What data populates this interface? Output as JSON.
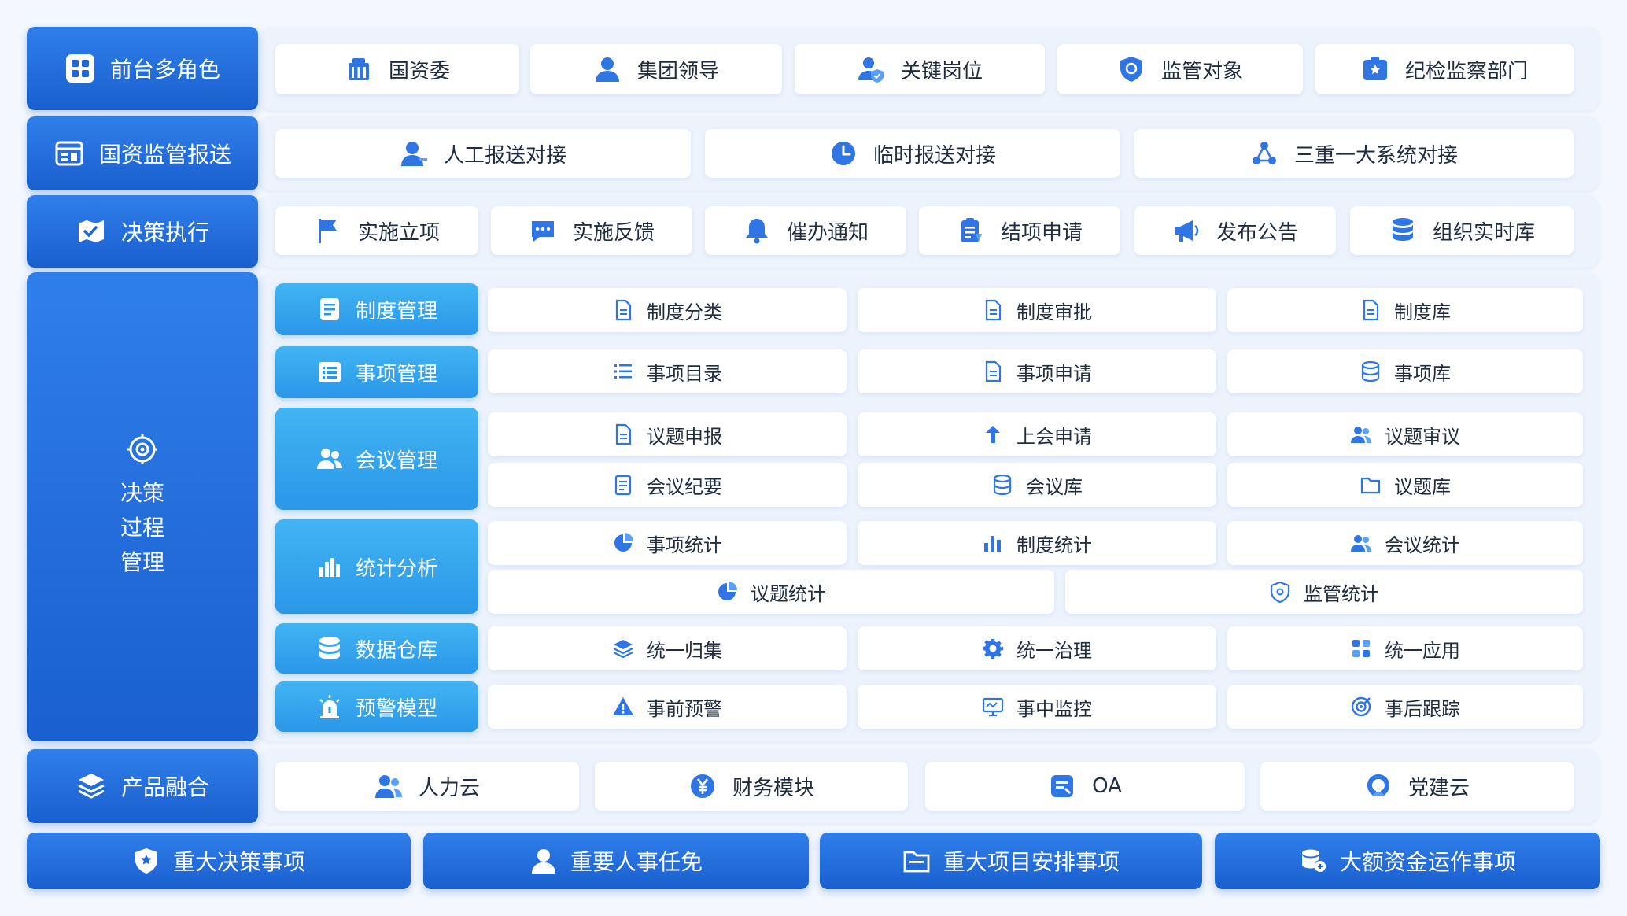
{
  "colors": {
    "primary": "#1a5fcf",
    "primary_light": "#2f7fea",
    "sub_accent": "#2a97e8",
    "icon_blue": "#2f76e4",
    "band_bg": "#edf3fc",
    "card_bg": "#ffffff",
    "text": "#1f2d3f"
  },
  "rows": {
    "roles": {
      "header": {
        "label": "前台多角色",
        "icon": "grid-icon"
      },
      "items": [
        {
          "label": "国资委",
          "icon": "building-icon"
        },
        {
          "label": "集团领导",
          "icon": "user-icon"
        },
        {
          "label": "关键岗位",
          "icon": "user-shield-icon"
        },
        {
          "label": "监管对象",
          "icon": "shield-icon"
        },
        {
          "label": "纪检监察部门",
          "icon": "badge-icon"
        }
      ]
    },
    "reporting": {
      "header": {
        "label": "国资监管报送",
        "icon": "report-icon"
      },
      "items": [
        {
          "label": "人工报送对接",
          "icon": "user-icon"
        },
        {
          "label": "临时报送对接",
          "icon": "clock-icon"
        },
        {
          "label": "三重一大系统对接",
          "icon": "network-icon"
        }
      ]
    },
    "execution": {
      "header": {
        "label": "决策执行",
        "icon": "check-map-icon"
      },
      "items": [
        {
          "label": "实施立项",
          "icon": "flag-icon"
        },
        {
          "label": "实施反馈",
          "icon": "chat-icon"
        },
        {
          "label": "催办通知",
          "icon": "bell-icon"
        },
        {
          "label": "结项申请",
          "icon": "clipboard-icon"
        },
        {
          "label": "发布公告",
          "icon": "megaphone-icon"
        },
        {
          "label": "组织实时库",
          "icon": "database-icon"
        }
      ]
    },
    "process": {
      "header": {
        "line1": "决策",
        "line2": "过程",
        "line3": "管理",
        "icon": "target-icon"
      },
      "modules": {
        "policy": {
          "label": "制度管理",
          "icon": "document-icon",
          "items": [
            {
              "label": "制度分类",
              "icon": "file-icon"
            },
            {
              "label": "制度审批",
              "icon": "file-icon"
            },
            {
              "label": "制度库",
              "icon": "file-icon"
            }
          ]
        },
        "matter": {
          "label": "事项管理",
          "icon": "list-icon",
          "items": [
            {
              "label": "事项目录",
              "icon": "list-icon"
            },
            {
              "label": "事项申请",
              "icon": "file-icon"
            },
            {
              "label": "事项库",
              "icon": "database-icon"
            }
          ]
        },
        "meeting": {
          "label": "会议管理",
          "icon": "users-icon",
          "items": [
            {
              "label": "议题申报",
              "icon": "file-icon"
            },
            {
              "label": "上会申请",
              "icon": "arrow-up-icon"
            },
            {
              "label": "议题审议",
              "icon": "users-icon"
            },
            {
              "label": "会议纪要",
              "icon": "notes-icon"
            },
            {
              "label": "会议库",
              "icon": "database-icon"
            },
            {
              "label": "议题库",
              "icon": "folder-icon"
            }
          ]
        },
        "stats": {
          "label": "统计分析",
          "icon": "bar-chart-icon",
          "items": [
            {
              "label": "事项统计",
              "icon": "pie-icon"
            },
            {
              "label": "制度统计",
              "icon": "bar-chart-icon"
            },
            {
              "label": "会议统计",
              "icon": "users-icon"
            },
            {
              "label": "议题统计",
              "icon": "pie-icon"
            },
            {
              "label": "监管统计",
              "icon": "shield-icon"
            }
          ]
        },
        "warehouse": {
          "label": "数据仓库",
          "icon": "database-icon",
          "items": [
            {
              "label": "统一归集",
              "icon": "layers-icon"
            },
            {
              "label": "统一治理",
              "icon": "gear-icon"
            },
            {
              "label": "统一应用",
              "icon": "apps-icon"
            }
          ]
        },
        "warning": {
          "label": "预警模型",
          "icon": "alarm-icon",
          "items": [
            {
              "label": "事前预警",
              "icon": "warning-icon"
            },
            {
              "label": "事中监控",
              "icon": "monitor-icon"
            },
            {
              "label": "事后跟踪",
              "icon": "target-icon"
            }
          ]
        }
      }
    },
    "products": {
      "header": {
        "label": "产品融合",
        "icon": "layers-icon"
      },
      "items": [
        {
          "label": "人力云",
          "icon": "users-icon"
        },
        {
          "label": "财务模块",
          "icon": "yen-icon"
        },
        {
          "label": "OA",
          "icon": "oa-icon"
        },
        {
          "label": "党建云",
          "icon": "party-icon"
        }
      ]
    }
  },
  "bottom": {
    "items": [
      {
        "label": "重大决策事项",
        "icon": "shield-star-icon"
      },
      {
        "label": "重要人事任免",
        "icon": "user-icon"
      },
      {
        "label": "重大项目安排事项",
        "icon": "folder-icon"
      },
      {
        "label": "大额资金运作事项",
        "icon": "coins-icon"
      }
    ]
  }
}
